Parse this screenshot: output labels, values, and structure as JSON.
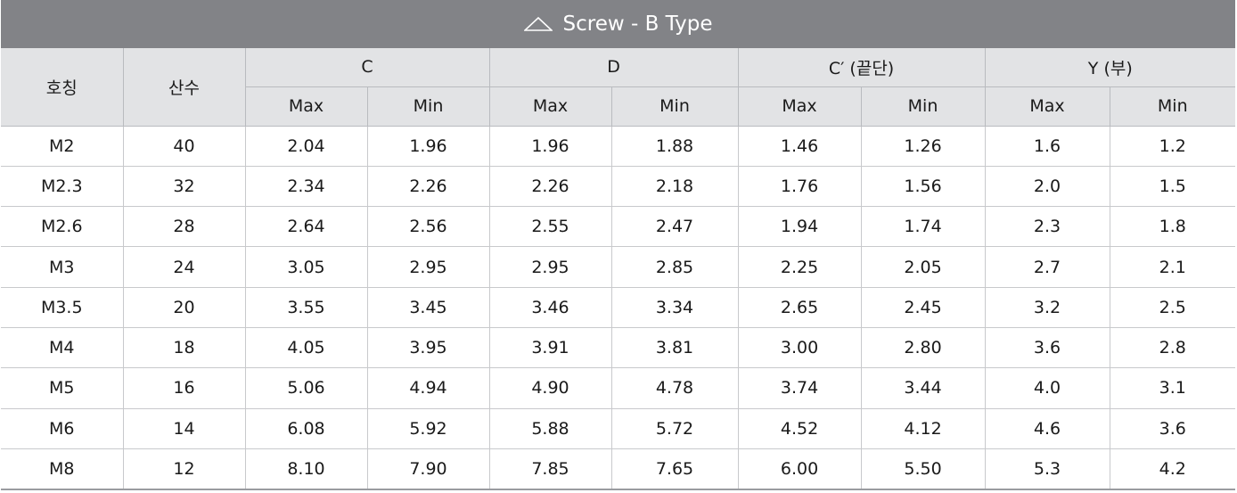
{
  "title": "Screw - B Type",
  "headers": {
    "nominal": "호칭",
    "threads": "산수",
    "groups": [
      "C",
      "D",
      "C′ (끝단)",
      "Y (부)"
    ],
    "max": "Max",
    "min": "Min"
  },
  "rows": [
    [
      "M2",
      "40",
      "2.04",
      "1.96",
      "1.96",
      "1.88",
      "1.46",
      "1.26",
      "1.6",
      "1.2"
    ],
    [
      "M2.3",
      "32",
      "2.34",
      "2.26",
      "2.26",
      "2.18",
      "1.76",
      "1.56",
      "2.0",
      "1.5"
    ],
    [
      "M2.6",
      "28",
      "2.64",
      "2.56",
      "2.55",
      "2.47",
      "1.94",
      "1.74",
      "2.3",
      "1.8"
    ],
    [
      "M3",
      "24",
      "3.05",
      "2.95",
      "2.95",
      "2.85",
      "2.25",
      "2.05",
      "2.7",
      "2.1"
    ],
    [
      "M3.5",
      "20",
      "3.55",
      "3.45",
      "3.46",
      "3.34",
      "2.65",
      "2.45",
      "3.2",
      "2.5"
    ],
    [
      "M4",
      "18",
      "4.05",
      "3.95",
      "3.91",
      "3.81",
      "3.00",
      "2.80",
      "3.6",
      "2.8"
    ],
    [
      "M5",
      "16",
      "5.06",
      "4.94",
      "4.90",
      "4.78",
      "3.74",
      "3.44",
      "4.0",
      "3.1"
    ],
    [
      "M6",
      "14",
      "6.08",
      "5.92",
      "5.88",
      "5.72",
      "4.52",
      "4.12",
      "4.6",
      "3.6"
    ],
    [
      "M8",
      "12",
      "8.10",
      "7.90",
      "7.85",
      "7.65",
      "6.00",
      "5.50",
      "5.3",
      "4.2"
    ]
  ]
}
